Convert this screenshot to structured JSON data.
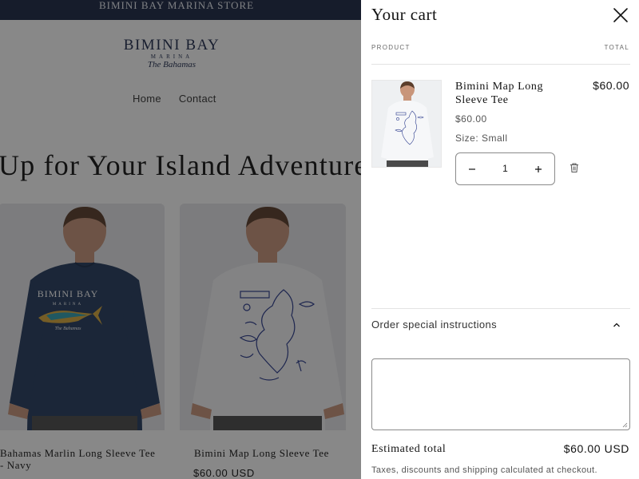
{
  "store": {
    "announcement": "BIMINI BAY MARINA STORE",
    "logo": {
      "main": "BIMINI BAY",
      "sub": "MARINA",
      "tagline": "The Bahamas"
    },
    "nav": [
      "Home",
      "Contact"
    ],
    "hero_title": "Up for Your Island Adventure",
    "products": [
      {
        "title": "Bahamas Marlin Long Sleeve Tee - Navy",
        "price": ""
      },
      {
        "title": "Bimini Map Long Sleeve Tee",
        "price": "$60.00 USD"
      }
    ],
    "shirt_print": {
      "brand": "BIMINI BAY",
      "sub": "MARINA",
      "tagline": "The Bahamas"
    }
  },
  "cart": {
    "heading": "Your cart",
    "columns": {
      "product": "PRODUCT",
      "total": "TOTAL"
    },
    "item": {
      "name": "Bimini Map Long Sleeve Tee",
      "total": "$60.00",
      "price": "$60.00",
      "option": "Size: Small",
      "quantity": "1"
    },
    "instructions_label": "Order special instructions",
    "estimated_total_label": "Estimated total",
    "estimated_total_value": "$60.00 USD",
    "tax_note": "Taxes, discounts and shipping calculated at checkout."
  },
  "colors": {
    "navy": "#1b2645",
    "overlay": "rgba(18,18,18,0.5)",
    "shirt_navy": "#243a5e",
    "shirt_white": "#f4f5f7",
    "map_ink": "#2a3a8c"
  },
  "icons": {
    "close": "close-icon",
    "minus": "minus-icon",
    "plus": "plus-icon",
    "trash": "trash-icon",
    "chevron": "chevron-up-icon"
  }
}
